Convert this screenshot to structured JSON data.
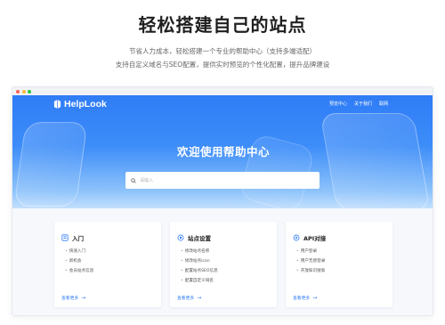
{
  "headline": "轻松搭建自己的站点",
  "subline1": "节省人力成本，轻松搭建一个专业的帮助中心（支持多端适配）",
  "subline2": "支持自定义域名与SEO配置，提供实时预览的个性化配置，提升品牌建设",
  "window_dots": [
    "#ff5f57",
    "#febc2e",
    "#28c840"
  ],
  "app": {
    "logo_text": "HelpLook",
    "nav": [
      "预览中心",
      "关于我们",
      "联网"
    ],
    "hero_title": "欢迎使用帮助中心",
    "search_placeholder": "请输入"
  },
  "cards": [
    {
      "title": "入门",
      "icon": "book-icon",
      "items": [
        "快速入门",
        "新机会",
        "会员站点信息"
      ],
      "more": "查看更多"
    },
    {
      "title": "站点设置",
      "icon": "settings-icon",
      "items": [
        "修改站点名称",
        "修改站点icon",
        "配置站点SEO信息",
        "配置自定义域名"
      ],
      "more": "查看更多"
    },
    {
      "title": "API对接",
      "icon": "api-icon",
      "items": [
        "用户登录",
        "用户无感登录",
        "开放知识搜索"
      ],
      "more": "查看更多"
    }
  ],
  "colors": {
    "accent": "#2f7cf6",
    "hero_top": "#2f7cf6",
    "hero_bottom": "#c4e0fd"
  }
}
